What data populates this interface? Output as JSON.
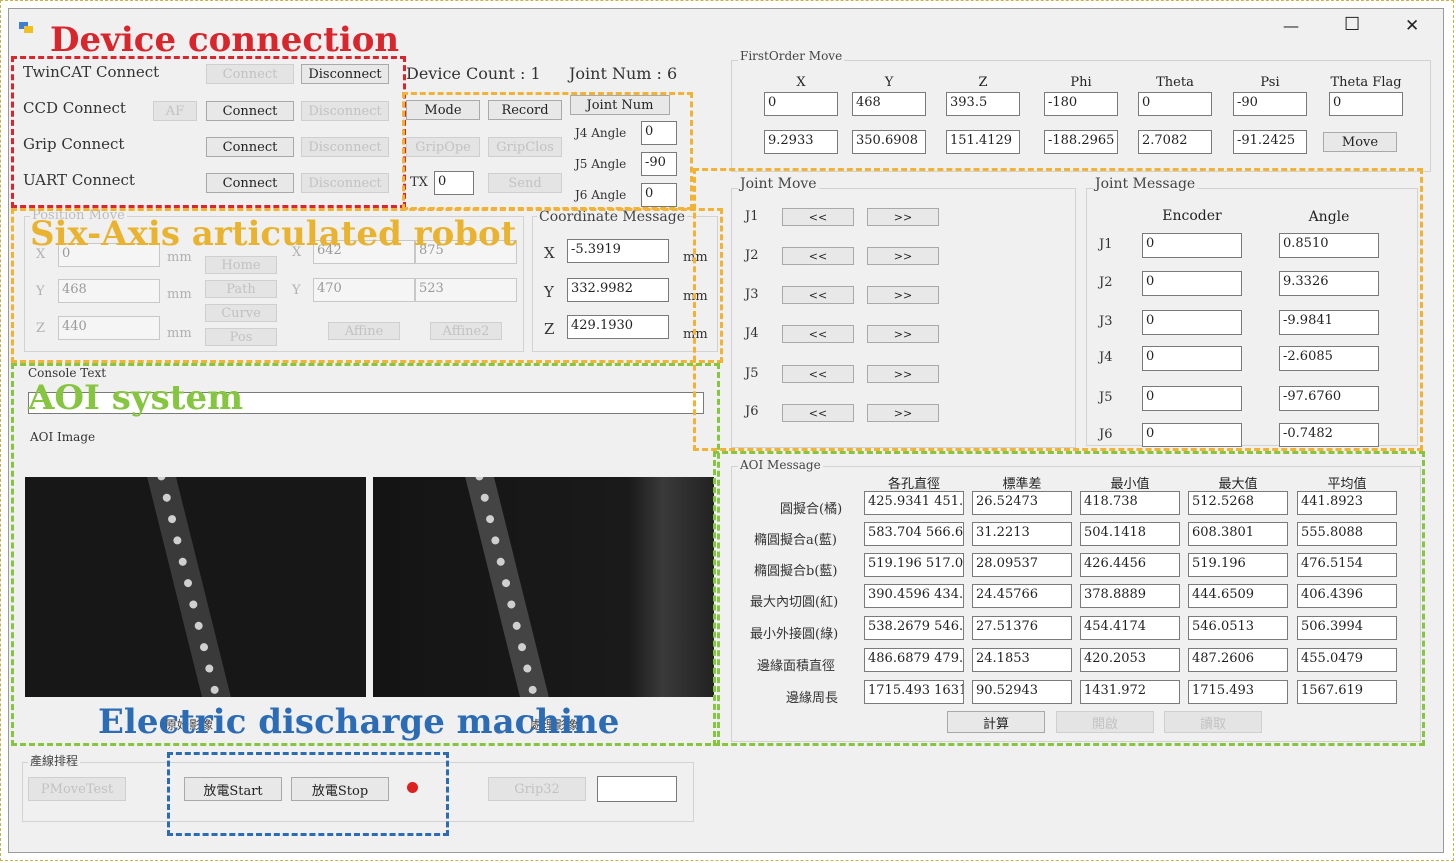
{
  "window": {
    "minimize": "—",
    "maximize": "☐",
    "close": "✕"
  },
  "annotations": {
    "device_connection": "Device connection",
    "six_axis": "Six-Axis articulated robot",
    "aoi_system": "AOI system",
    "edm": "Electric discharge machine"
  },
  "connections": {
    "twincat_label": "TwinCAT Connect",
    "twincat_connect": "Connect",
    "twincat_disconnect": "Disconnect",
    "ccd_label": "CCD Connect",
    "ccd_af": "AF",
    "ccd_connect": "Connect",
    "ccd_disconnect": "Disconnect",
    "grip_label": "Grip Connect",
    "grip_connect": "Connect",
    "grip_disconnect": "Disconnect",
    "uart_label": "UART Connect",
    "uart_connect": "Connect",
    "uart_disconnect": "Disconnect"
  },
  "status": {
    "device_count": "Device Count : 1",
    "joint_num": "Joint Num : 6"
  },
  "mid_controls": {
    "mode": "Mode",
    "record": "Record",
    "joint_num_btn": "Joint Num",
    "grip_open": "GripOpe",
    "grip_close": "GripClos",
    "tx_label": "TX",
    "tx_value": "0",
    "send": "Send",
    "j4_label": "J4 Angle",
    "j4_value": "0",
    "j5_label": "J5 Angle",
    "j5_value": "-90",
    "j6_label": "J6 Angle",
    "j6_value": "0"
  },
  "position_move": {
    "title": "Position Move",
    "x_label": "X",
    "x_value": "0",
    "y_label": "Y",
    "y_value": "468",
    "z_label": "Z",
    "z_value": "440",
    "unit": "mm",
    "home": "Home",
    "path": "Path",
    "curve": "Curve",
    "pos": "Pos",
    "x2_label": "X",
    "x2a": "642",
    "x2b": "875",
    "y2_label": "Y",
    "y2a": "470",
    "y2b": "523",
    "affine": "Affine",
    "affine2": "Affine2"
  },
  "coord_message": {
    "title": "Coordinate Message",
    "x_label": "X",
    "x_value": "-5.3919",
    "y_label": "Y",
    "y_value": "332.9982",
    "z_label": "Z",
    "z_value": "429.1930",
    "unit": "mm"
  },
  "first_order": {
    "title": "FirstOrder Move",
    "headers": [
      "X",
      "Y",
      "Z",
      "Phi",
      "Theta",
      "Psi",
      "Theta Flag"
    ],
    "row1": [
      "0",
      "468",
      "393.5",
      "-180",
      "0",
      "-90",
      "0"
    ],
    "row2": [
      "9.2933",
      "350.6908",
      "151.4129",
      "-188.2965",
      "2.7082",
      "-91.2425"
    ],
    "move": "Move"
  },
  "joint_move": {
    "title": "Joint Move",
    "joints": [
      "J1",
      "J2",
      "J3",
      "J4",
      "J5",
      "J6"
    ],
    "left": "<<",
    "right": ">>"
  },
  "joint_message": {
    "title": "Joint Message",
    "encoder_header": "Encoder",
    "angle_header": "Angle",
    "rows": [
      {
        "joint": "J1",
        "encoder": "0",
        "angle": "0.8510"
      },
      {
        "joint": "J2",
        "encoder": "0",
        "angle": "9.3326"
      },
      {
        "joint": "J3",
        "encoder": "0",
        "angle": "-9.9841"
      },
      {
        "joint": "J4",
        "encoder": "0",
        "angle": "-2.6085"
      },
      {
        "joint": "J5",
        "encoder": "0",
        "angle": "-97.6760"
      },
      {
        "joint": "J6",
        "encoder": "0",
        "angle": "-0.7482"
      }
    ]
  },
  "console": {
    "title": "Console Text",
    "value": ""
  },
  "aoi_image": {
    "title": "AOI Image",
    "left_caption": "原始影像",
    "right_caption": "處理影像"
  },
  "aoi_message": {
    "title": "AOI Message",
    "headers": [
      "各孔直徑",
      "標準差",
      "最小值",
      "最大值",
      "平均值"
    ],
    "rows": [
      {
        "label": "圓擬合(橘)",
        "values": [
          "425.9341 451.",
          "26.52473",
          "418.738",
          "512.5268",
          "441.8923"
        ]
      },
      {
        "label": "橢圓擬合a(藍)",
        "values": [
          "583.704 566.6",
          "31.2213",
          "504.1418",
          "608.3801",
          "555.8088"
        ]
      },
      {
        "label": "橢圓擬合b(藍)",
        "values": [
          "519.196 517.0",
          "28.09537",
          "426.4456",
          "519.196",
          "476.5154"
        ]
      },
      {
        "label": "最大內切圓(紅)",
        "values": [
          "390.4596 434.",
          "24.45766",
          "378.8889",
          "444.6509",
          "406.4396"
        ]
      },
      {
        "label": "最小外接圓(綠)",
        "values": [
          "538.2679 546.",
          "27.51376",
          "454.4174",
          "546.0513",
          "506.3994"
        ]
      },
      {
        "label": "邊緣面積直徑",
        "values": [
          "486.6879 479.",
          "24.1853",
          "420.2053",
          "487.2606",
          "455.0479"
        ]
      },
      {
        "label": "邊緣周長",
        "values": [
          "1715.493 1631",
          "90.52943",
          "1431.972",
          "1715.493",
          "1567.619"
        ]
      }
    ],
    "calc": "計算",
    "open": "開啟",
    "read": "讀取"
  },
  "bottom": {
    "group_title": "產線排程",
    "pmove_test": "PMoveTest",
    "edm_start": "放電Start",
    "edm_stop": "放電Stop",
    "grip_btn": "Grip32",
    "grip_value": ""
  },
  "colors": {
    "red": "#d9262c",
    "yellow": "#f2b233",
    "green": "#86c540",
    "blue": "#2c6cb5",
    "indicator": "#e02020"
  }
}
